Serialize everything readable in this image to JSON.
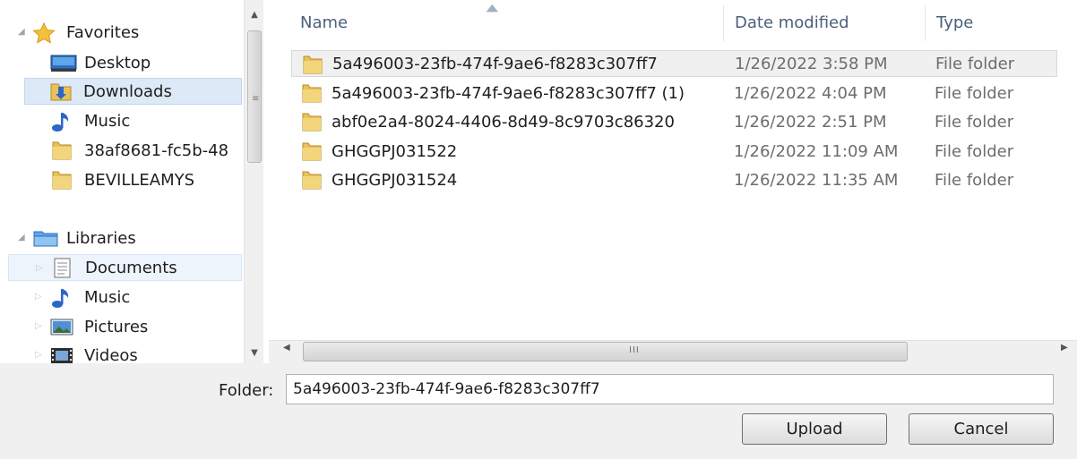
{
  "nav": {
    "favorites": {
      "label": "Favorites",
      "items": [
        {
          "label": "Desktop",
          "icon": "desktop-icon"
        },
        {
          "label": "Downloads",
          "icon": "downloads-folder-icon"
        },
        {
          "label": "Music",
          "icon": "music-note-icon"
        },
        {
          "label": "38af8681-fc5b-48",
          "icon": "folder-icon"
        },
        {
          "label": "BEVILLEAMYS",
          "icon": "folder-icon"
        }
      ]
    },
    "libraries": {
      "label": "Libraries",
      "items": [
        {
          "label": "Documents",
          "icon": "documents-icon"
        },
        {
          "label": "Music",
          "icon": "music-note-icon"
        },
        {
          "label": "Pictures",
          "icon": "pictures-icon"
        },
        {
          "label": "Videos",
          "icon": "videos-icon"
        }
      ]
    }
  },
  "columns": {
    "name": "Name",
    "date": "Date modified",
    "type": "Type"
  },
  "files": [
    {
      "name": "5a496003-23fb-474f-9ae6-f8283c307ff7",
      "date": "1/26/2022 3:58 PM",
      "type": "File folder"
    },
    {
      "name": "5a496003-23fb-474f-9ae6-f8283c307ff7 (1)",
      "date": "1/26/2022 4:04 PM",
      "type": "File folder"
    },
    {
      "name": "abf0e2a4-8024-4406-8d49-8c9703c86320",
      "date": "1/26/2022 2:51 PM",
      "type": "File folder"
    },
    {
      "name": "GHGGPJ031522",
      "date": "1/26/2022 11:09 AM",
      "type": "File folder"
    },
    {
      "name": "GHGGPJ031524",
      "date": "1/26/2022 11:35 AM",
      "type": "File folder"
    }
  ],
  "footer": {
    "folder_label": "Folder:",
    "folder_value": "5a496003-23fb-474f-9ae6-f8283c307ff7",
    "upload_label": "Upload",
    "cancel_label": "Cancel"
  },
  "colors": {
    "selection_bg": "#dde9f7",
    "header_text": "#4c607a",
    "folder_yellow": "#e8c15a"
  }
}
